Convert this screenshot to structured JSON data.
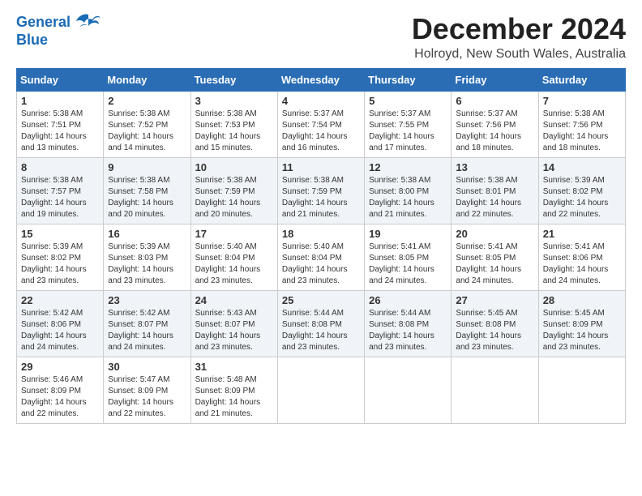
{
  "logo": {
    "line1": "General",
    "line2": "Blue"
  },
  "title": "December 2024",
  "location": "Holroyd, New South Wales, Australia",
  "days_of_week": [
    "Sunday",
    "Monday",
    "Tuesday",
    "Wednesday",
    "Thursday",
    "Friday",
    "Saturday"
  ],
  "weeks": [
    [
      {
        "day": "1",
        "info": "Sunrise: 5:38 AM\nSunset: 7:51 PM\nDaylight: 14 hours\nand 13 minutes."
      },
      {
        "day": "2",
        "info": "Sunrise: 5:38 AM\nSunset: 7:52 PM\nDaylight: 14 hours\nand 14 minutes."
      },
      {
        "day": "3",
        "info": "Sunrise: 5:38 AM\nSunset: 7:53 PM\nDaylight: 14 hours\nand 15 minutes."
      },
      {
        "day": "4",
        "info": "Sunrise: 5:37 AM\nSunset: 7:54 PM\nDaylight: 14 hours\nand 16 minutes."
      },
      {
        "day": "5",
        "info": "Sunrise: 5:37 AM\nSunset: 7:55 PM\nDaylight: 14 hours\nand 17 minutes."
      },
      {
        "day": "6",
        "info": "Sunrise: 5:37 AM\nSunset: 7:56 PM\nDaylight: 14 hours\nand 18 minutes."
      },
      {
        "day": "7",
        "info": "Sunrise: 5:38 AM\nSunset: 7:56 PM\nDaylight: 14 hours\nand 18 minutes."
      }
    ],
    [
      {
        "day": "8",
        "info": "Sunrise: 5:38 AM\nSunset: 7:57 PM\nDaylight: 14 hours\nand 19 minutes."
      },
      {
        "day": "9",
        "info": "Sunrise: 5:38 AM\nSunset: 7:58 PM\nDaylight: 14 hours\nand 20 minutes."
      },
      {
        "day": "10",
        "info": "Sunrise: 5:38 AM\nSunset: 7:59 PM\nDaylight: 14 hours\nand 20 minutes."
      },
      {
        "day": "11",
        "info": "Sunrise: 5:38 AM\nSunset: 7:59 PM\nDaylight: 14 hours\nand 21 minutes."
      },
      {
        "day": "12",
        "info": "Sunrise: 5:38 AM\nSunset: 8:00 PM\nDaylight: 14 hours\nand 21 minutes."
      },
      {
        "day": "13",
        "info": "Sunrise: 5:38 AM\nSunset: 8:01 PM\nDaylight: 14 hours\nand 22 minutes."
      },
      {
        "day": "14",
        "info": "Sunrise: 5:39 AM\nSunset: 8:02 PM\nDaylight: 14 hours\nand 22 minutes."
      }
    ],
    [
      {
        "day": "15",
        "info": "Sunrise: 5:39 AM\nSunset: 8:02 PM\nDaylight: 14 hours\nand 23 minutes."
      },
      {
        "day": "16",
        "info": "Sunrise: 5:39 AM\nSunset: 8:03 PM\nDaylight: 14 hours\nand 23 minutes."
      },
      {
        "day": "17",
        "info": "Sunrise: 5:40 AM\nSunset: 8:04 PM\nDaylight: 14 hours\nand 23 minutes."
      },
      {
        "day": "18",
        "info": "Sunrise: 5:40 AM\nSunset: 8:04 PM\nDaylight: 14 hours\nand 23 minutes."
      },
      {
        "day": "19",
        "info": "Sunrise: 5:41 AM\nSunset: 8:05 PM\nDaylight: 14 hours\nand 24 minutes."
      },
      {
        "day": "20",
        "info": "Sunrise: 5:41 AM\nSunset: 8:05 PM\nDaylight: 14 hours\nand 24 minutes."
      },
      {
        "day": "21",
        "info": "Sunrise: 5:41 AM\nSunset: 8:06 PM\nDaylight: 14 hours\nand 24 minutes."
      }
    ],
    [
      {
        "day": "22",
        "info": "Sunrise: 5:42 AM\nSunset: 8:06 PM\nDaylight: 14 hours\nand 24 minutes."
      },
      {
        "day": "23",
        "info": "Sunrise: 5:42 AM\nSunset: 8:07 PM\nDaylight: 14 hours\nand 24 minutes."
      },
      {
        "day": "24",
        "info": "Sunrise: 5:43 AM\nSunset: 8:07 PM\nDaylight: 14 hours\nand 23 minutes."
      },
      {
        "day": "25",
        "info": "Sunrise: 5:44 AM\nSunset: 8:08 PM\nDaylight: 14 hours\nand 23 minutes."
      },
      {
        "day": "26",
        "info": "Sunrise: 5:44 AM\nSunset: 8:08 PM\nDaylight: 14 hours\nand 23 minutes."
      },
      {
        "day": "27",
        "info": "Sunrise: 5:45 AM\nSunset: 8:08 PM\nDaylight: 14 hours\nand 23 minutes."
      },
      {
        "day": "28",
        "info": "Sunrise: 5:45 AM\nSunset: 8:09 PM\nDaylight: 14 hours\nand 23 minutes."
      }
    ],
    [
      {
        "day": "29",
        "info": "Sunrise: 5:46 AM\nSunset: 8:09 PM\nDaylight: 14 hours\nand 22 minutes."
      },
      {
        "day": "30",
        "info": "Sunrise: 5:47 AM\nSunset: 8:09 PM\nDaylight: 14 hours\nand 22 minutes."
      },
      {
        "day": "31",
        "info": "Sunrise: 5:48 AM\nSunset: 8:09 PM\nDaylight: 14 hours\nand 21 minutes."
      },
      {
        "day": "",
        "info": ""
      },
      {
        "day": "",
        "info": ""
      },
      {
        "day": "",
        "info": ""
      },
      {
        "day": "",
        "info": ""
      }
    ]
  ]
}
